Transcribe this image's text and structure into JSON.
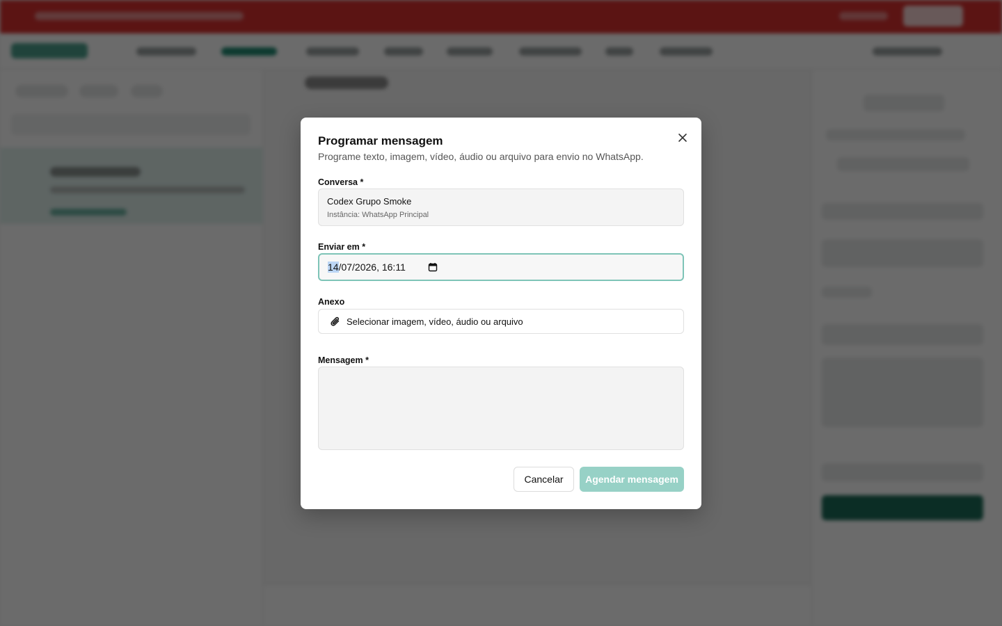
{
  "modal": {
    "title": "Programar mensagem",
    "description": "Programe texto, imagem, vídeo, áudio ou arquivo para envio no WhatsApp.",
    "close_icon": "close-icon",
    "conversation": {
      "label": "Conversa *",
      "name": "Codex Grupo Smoke",
      "instance": "Instância: WhatsApp Principal"
    },
    "send_at": {
      "label": "Enviar em *",
      "day": "14",
      "rest": "/07/2026, 16:11",
      "icon": "calendar-icon"
    },
    "attachment": {
      "label": "Anexo",
      "button_text": "Selecionar imagem, vídeo, áudio ou arquivo",
      "icon": "paperclip-icon"
    },
    "message": {
      "label": "Mensagem *",
      "value": ""
    },
    "buttons": {
      "cancel": "Cancelar",
      "submit": "Agendar mensagem"
    }
  },
  "colors": {
    "accent_focus": "#7ec4b7",
    "submit_disabled": "#97d1c6",
    "banner": "#d8302f",
    "brand": "#1f8a72"
  }
}
